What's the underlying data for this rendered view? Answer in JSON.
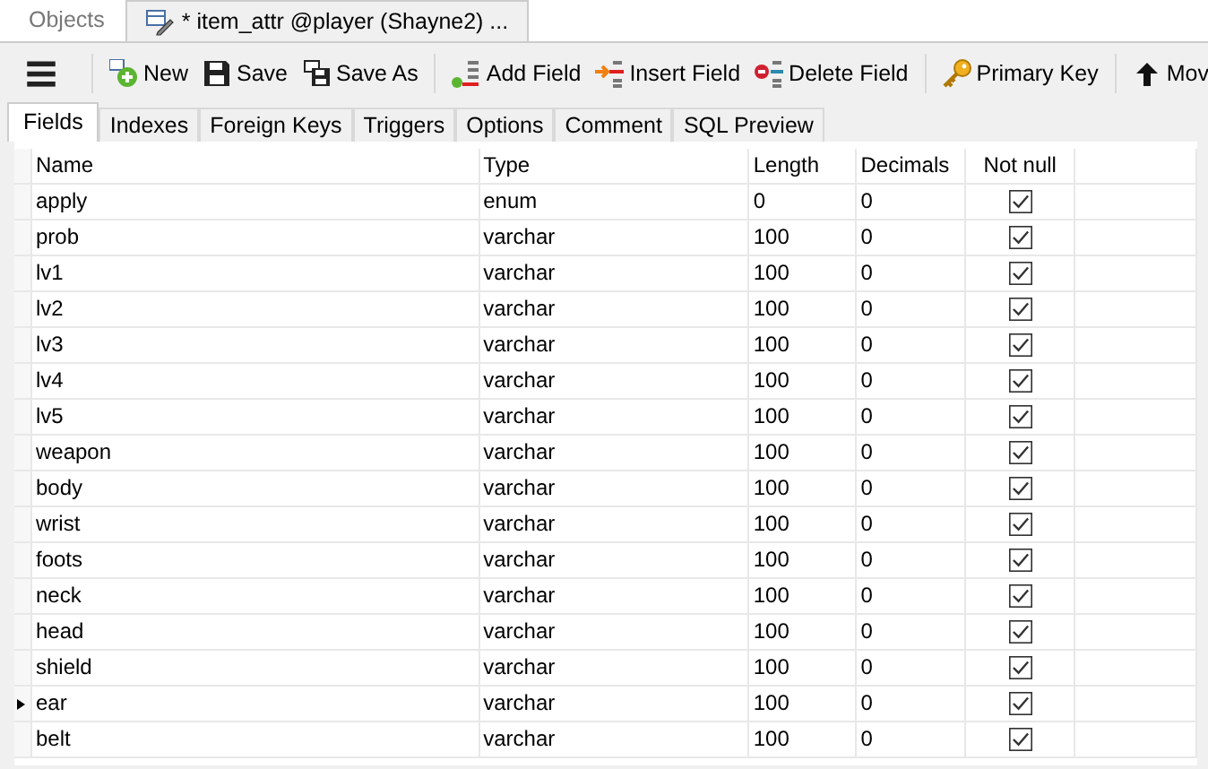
{
  "window_tabs": [
    {
      "label": "Objects",
      "selected": false
    },
    {
      "label": "* item_attr @player (Shayne2) ...",
      "selected": true
    }
  ],
  "toolbar": [
    {
      "kind": "menu"
    },
    {
      "kind": "new",
      "label": "New"
    },
    {
      "kind": "save",
      "label": "Save"
    },
    {
      "kind": "saveas",
      "label": "Save As"
    },
    {
      "kind": "sep"
    },
    {
      "kind": "addfield",
      "label": "Add Field"
    },
    {
      "kind": "insertfield",
      "label": "Insert Field"
    },
    {
      "kind": "deletefield",
      "label": "Delete Field"
    },
    {
      "kind": "sep"
    },
    {
      "kind": "primarykey",
      "label": "Primary Key"
    },
    {
      "kind": "sep"
    },
    {
      "kind": "moveup",
      "label": "Mov"
    }
  ],
  "tabs": [
    {
      "label": "Fields",
      "selected": true
    },
    {
      "label": "Indexes",
      "selected": false
    },
    {
      "label": "Foreign Keys",
      "selected": false
    },
    {
      "label": "Triggers",
      "selected": false
    },
    {
      "label": "Options",
      "selected": false
    },
    {
      "label": "Comment",
      "selected": false
    },
    {
      "label": "SQL Preview",
      "selected": false
    }
  ],
  "table": {
    "columns": [
      "Name",
      "Type",
      "Length",
      "Decimals",
      "Not null"
    ],
    "rows": [
      {
        "name": "apply",
        "type": "enum",
        "length": "0",
        "decimals": "0",
        "not_null": true,
        "selected": false
      },
      {
        "name": "prob",
        "type": "varchar",
        "length": "100",
        "decimals": "0",
        "not_null": true,
        "selected": false
      },
      {
        "name": "lv1",
        "type": "varchar",
        "length": "100",
        "decimals": "0",
        "not_null": true,
        "selected": false
      },
      {
        "name": "lv2",
        "type": "varchar",
        "length": "100",
        "decimals": "0",
        "not_null": true,
        "selected": false
      },
      {
        "name": "lv3",
        "type": "varchar",
        "length": "100",
        "decimals": "0",
        "not_null": true,
        "selected": false
      },
      {
        "name": "lv4",
        "type": "varchar",
        "length": "100",
        "decimals": "0",
        "not_null": true,
        "selected": false
      },
      {
        "name": "lv5",
        "type": "varchar",
        "length": "100",
        "decimals": "0",
        "not_null": true,
        "selected": false
      },
      {
        "name": "weapon",
        "type": "varchar",
        "length": "100",
        "decimals": "0",
        "not_null": true,
        "selected": false
      },
      {
        "name": "body",
        "type": "varchar",
        "length": "100",
        "decimals": "0",
        "not_null": true,
        "selected": false
      },
      {
        "name": "wrist",
        "type": "varchar",
        "length": "100",
        "decimals": "0",
        "not_null": true,
        "selected": false
      },
      {
        "name": "foots",
        "type": "varchar",
        "length": "100",
        "decimals": "0",
        "not_null": true,
        "selected": false
      },
      {
        "name": "neck",
        "type": "varchar",
        "length": "100",
        "decimals": "0",
        "not_null": true,
        "selected": false
      },
      {
        "name": "head",
        "type": "varchar",
        "length": "100",
        "decimals": "0",
        "not_null": true,
        "selected": false
      },
      {
        "name": "shield",
        "type": "varchar",
        "length": "100",
        "decimals": "0",
        "not_null": true,
        "selected": false
      },
      {
        "name": "ear",
        "type": "varchar",
        "length": "100",
        "decimals": "0",
        "not_null": true,
        "selected": true
      },
      {
        "name": "belt",
        "type": "varchar",
        "length": "100",
        "decimals": "0",
        "not_null": true,
        "selected": false
      }
    ]
  }
}
